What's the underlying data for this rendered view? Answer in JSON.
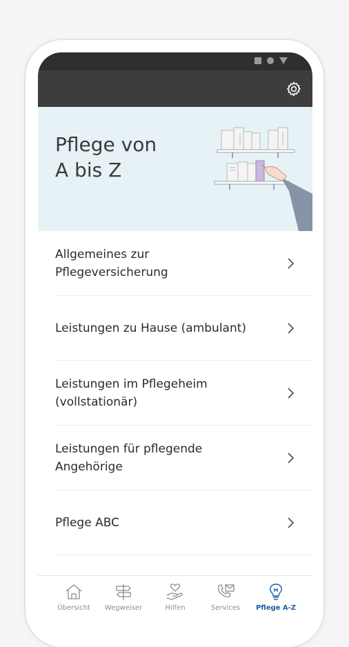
{
  "header": {
    "settings_icon": "gear-icon"
  },
  "hero": {
    "title_line1": "Pflege von",
    "title_line2": "A bis Z",
    "background": "#e6f2f6"
  },
  "menu": {
    "items": [
      {
        "line1": "Allgemeines zur Pflegeversicherung",
        "line2": ""
      },
      {
        "line1": "Leistungen zu Hause (ambulant)",
        "line2": ""
      },
      {
        "line1": "Leistungen im Pflegeheim",
        "line2": "(vollstationär)"
      },
      {
        "line1": "Leistungen für pflegende",
        "line2": "Angehörige"
      },
      {
        "line1": "Pflege ABC",
        "line2": ""
      }
    ]
  },
  "bottom_nav": {
    "items": [
      {
        "label": "Übersicht",
        "icon": "home-icon"
      },
      {
        "label": "Wegweiser",
        "icon": "signpost-icon"
      },
      {
        "label": "Hilfen",
        "icon": "heart-hand-icon"
      },
      {
        "label": "Services",
        "icon": "phone-mail-icon"
      },
      {
        "label": "Pflege A-Z",
        "icon": "lightbulb-icon"
      }
    ],
    "active_color": "#1b5fa7",
    "inactive_color": "#8c8c8c"
  }
}
